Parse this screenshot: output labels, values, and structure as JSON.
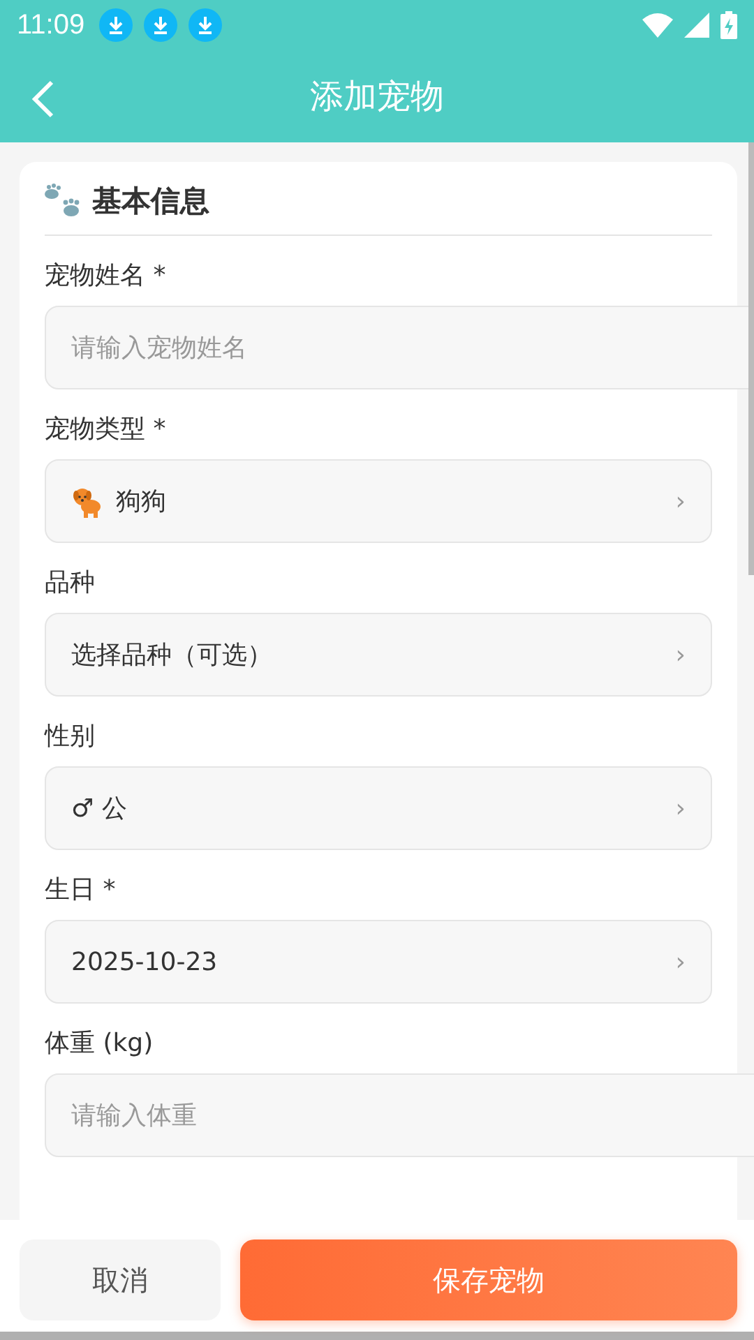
{
  "status_bar": {
    "time": "11:09",
    "notifications": [
      {
        "kind": "download"
      },
      {
        "kind": "download"
      },
      {
        "kind": "download"
      }
    ]
  },
  "header": {
    "title": "添加宠物"
  },
  "section": {
    "title": "基本信息"
  },
  "fields": [
    {
      "kind": "input",
      "label": "宠物姓名 *",
      "placeholder": "请输入宠物姓名"
    },
    {
      "kind": "pet-select",
      "label": "宠物类型 *",
      "value": "狗狗",
      "chevron": "›"
    },
    {
      "kind": "select",
      "label": "品种",
      "value": "选择品种（可选）",
      "chevron": "›"
    },
    {
      "kind": "select",
      "label": "性别",
      "value": "♂ 公",
      "chevron": "›"
    },
    {
      "kind": "select",
      "label": "生日 *",
      "value": "2025-10-23",
      "chevron": "›"
    },
    {
      "kind": "input",
      "label": "体重 (kg)",
      "placeholder": "请输入体重"
    }
  ],
  "buttons": [
    {
      "kind": "secondary",
      "label": "取消"
    },
    {
      "kind": "primary",
      "label": "保存宠物"
    }
  ]
}
